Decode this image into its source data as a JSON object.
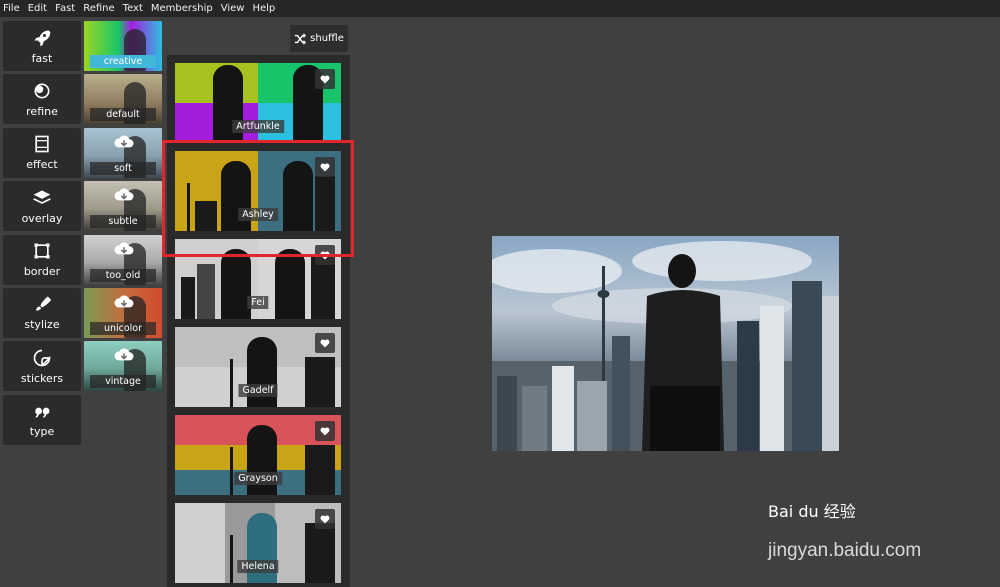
{
  "menu": [
    "File",
    "Edit",
    "Fast",
    "Refine",
    "Text",
    "Membership",
    "View",
    "Help"
  ],
  "tools": [
    {
      "label": "fast",
      "icon": "rocket-icon"
    },
    {
      "label": "refine",
      "icon": "refine-icon"
    },
    {
      "label": "effect",
      "icon": "film-icon"
    },
    {
      "label": "overlay",
      "icon": "layers-icon"
    },
    {
      "label": "border",
      "icon": "border-icon"
    },
    {
      "label": "stylize",
      "icon": "brush-icon"
    },
    {
      "label": "stickers",
      "icon": "sticker-icon"
    },
    {
      "label": "type",
      "icon": "quote-icon"
    }
  ],
  "categories": [
    {
      "label": "creative",
      "active": true
    },
    {
      "label": "default",
      "active": false
    },
    {
      "label": "soft",
      "active": false
    },
    {
      "label": "subtle",
      "active": false
    },
    {
      "label": "too_old",
      "active": false
    },
    {
      "label": "unicolor",
      "active": false
    },
    {
      "label": "vintage",
      "active": false
    }
  ],
  "shuffle_label": "shuffle",
  "filters": [
    {
      "name": "Artfunkle",
      "colors": [
        "#a7c31f",
        "#18c46a",
        "#a51ddc",
        "#2cc0e0"
      ]
    },
    {
      "name": "Ashley",
      "colors": [
        "#c9a417",
        "#c9a417",
        "#3d6f82",
        "#3d6f82"
      ]
    },
    {
      "name": "Fei",
      "colors": [
        "#cfcfcf",
        "#6d6d6d",
        "#d6d6d6",
        "#8a8a8a"
      ]
    },
    {
      "name": "Gadelf",
      "colors": [
        "#bfbfbf",
        "#7a7a7a",
        "#d0d0d0",
        "#a0a0a0"
      ]
    },
    {
      "name": "Grayson",
      "colors": [
        "#d9535a",
        "#c9a417",
        "#c9a417",
        "#3d6f82"
      ]
    },
    {
      "name": "Helena",
      "colors": [
        "#d0d0d0",
        "#9a9a9a",
        "#2f6e7e",
        "#bdbdbd"
      ]
    }
  ],
  "watermark": {
    "brand": "Bai du 经验",
    "url": "jingyan.baidu.com"
  }
}
